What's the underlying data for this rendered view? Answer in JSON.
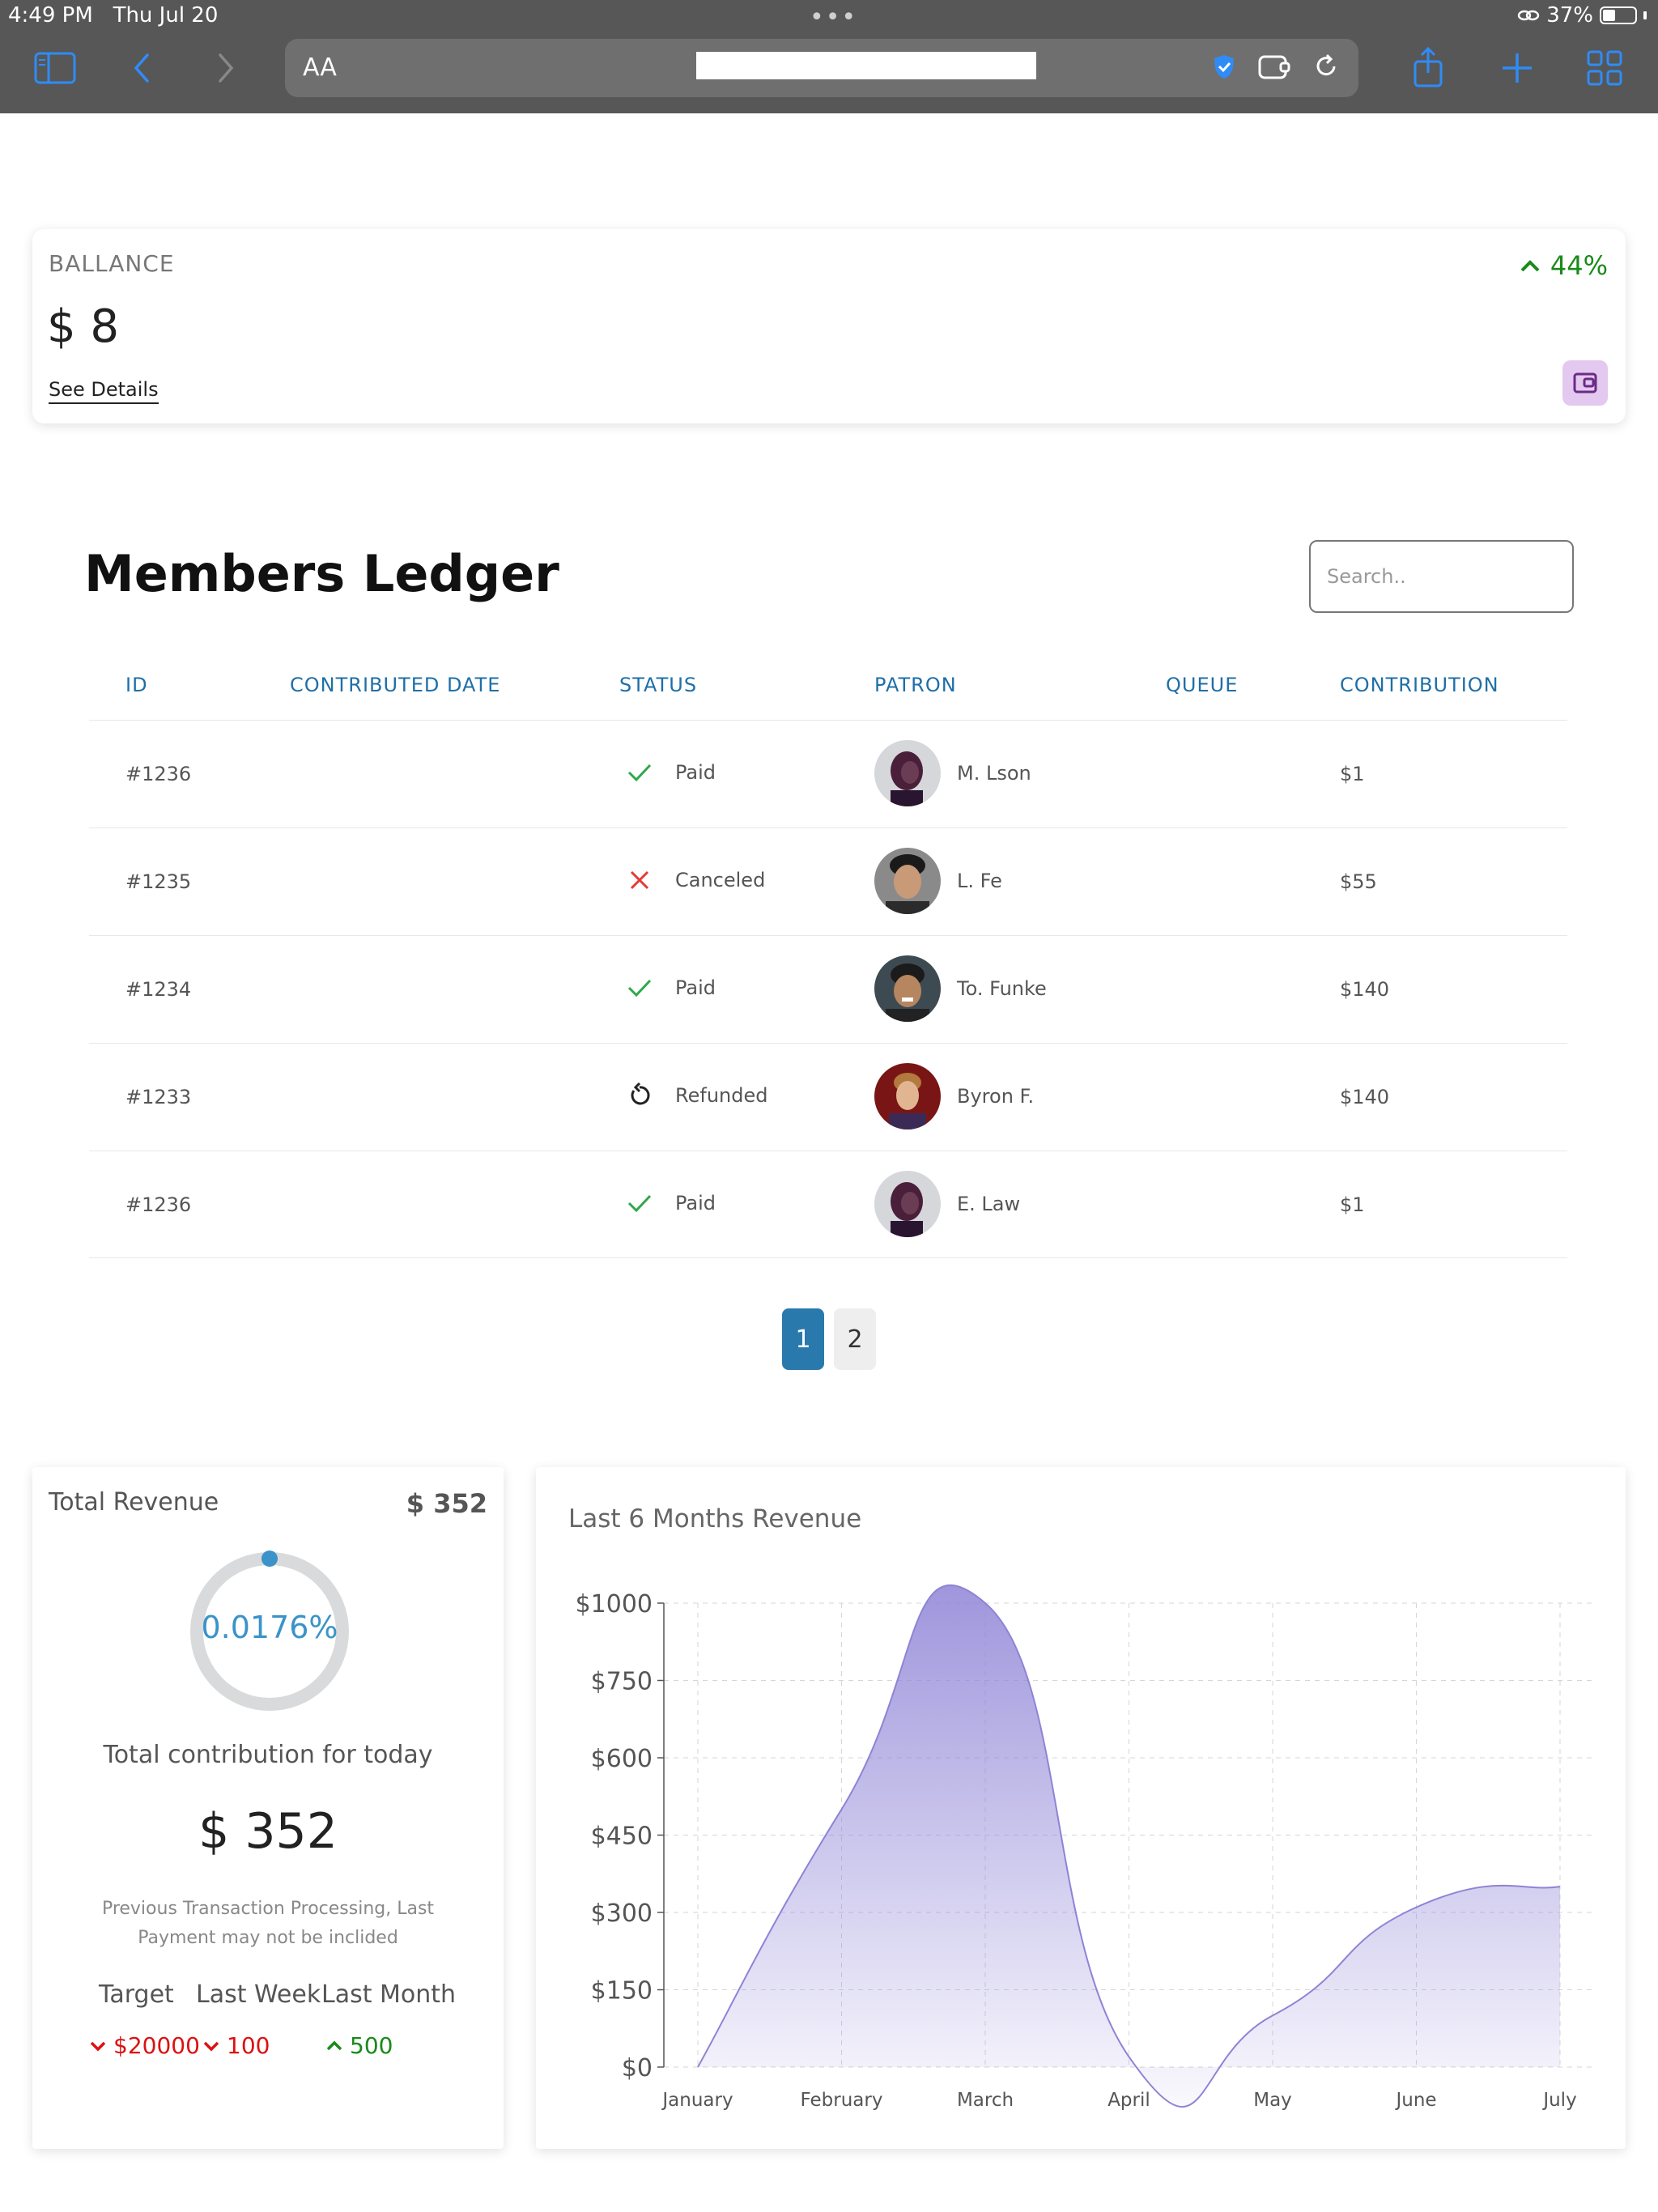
{
  "status_bar": {
    "time": "4:49 PM",
    "date": "Thu Jul 20",
    "battery": "37%"
  },
  "browser": {
    "text_size_label": "AA"
  },
  "balance": {
    "label": "BALLANCE",
    "value": "$ 8",
    "link": "See Details",
    "growth": "44%",
    "growth_color": "#1a8a1a"
  },
  "ledger": {
    "title": "Members Ledger",
    "search_placeholder": "Search..",
    "columns": [
      "ID",
      "CONTRIBUTED DATE",
      "STATUS",
      "PATRON",
      "QUEUE",
      "CONTRIBUTION"
    ],
    "rows": [
      {
        "id": "#1236",
        "status": "Paid",
        "status_icon": "check-icon",
        "patron": "M. Lson",
        "avatar": "avatar-purple",
        "amount": "$1"
      },
      {
        "id": "#1235",
        "status": "Canceled",
        "status_icon": "x-icon",
        "patron": "L. Fe",
        "avatar": "avatar-man-dark",
        "amount": "$55"
      },
      {
        "id": "#1234",
        "status": "Paid",
        "status_icon": "check-icon",
        "patron": "To. Funke",
        "avatar": "avatar-man-smile",
        "amount": "$140"
      },
      {
        "id": "#1233",
        "status": "Refunded",
        "status_icon": "refund-icon",
        "patron": "Byron F.",
        "avatar": "avatar-man-red",
        "amount": "$140"
      },
      {
        "id": "#1236",
        "status": "Paid",
        "status_icon": "check-icon",
        "patron": "E. Law",
        "avatar": "avatar-purple",
        "amount": "$1"
      }
    ],
    "pages": [
      "1",
      "2"
    ],
    "active_page": "1",
    "accent_color": "#2979ad"
  },
  "revenue": {
    "label": "Total Revenue",
    "total": "$ 352",
    "percent": "0.0176%",
    "today_label": "Total contribution for today",
    "today_value": "$ 352",
    "note": "Previous Transaction Processing, Last Payment may not be inclided",
    "stats": [
      {
        "label": "Target",
        "value": "$20000",
        "trend": "down"
      },
      {
        "label": "Last Week",
        "value": "100",
        "trend": "down"
      },
      {
        "label": "Last Month",
        "value": "500",
        "trend": "up"
      }
    ]
  },
  "chart_data": {
    "type": "area",
    "title": "Last 6 Months Revenue",
    "categories": [
      "January",
      "February",
      "March",
      "April",
      "May",
      "June",
      "July"
    ],
    "values": [
      0,
      500,
      1000,
      20,
      100,
      310,
      350
    ],
    "y_ticks": [
      "$0",
      "$150",
      "$300",
      "$450",
      "$600",
      "$750",
      "$1000"
    ],
    "xlabel": "",
    "ylabel": "",
    "grid": true,
    "line_color": "#8e83d6"
  }
}
